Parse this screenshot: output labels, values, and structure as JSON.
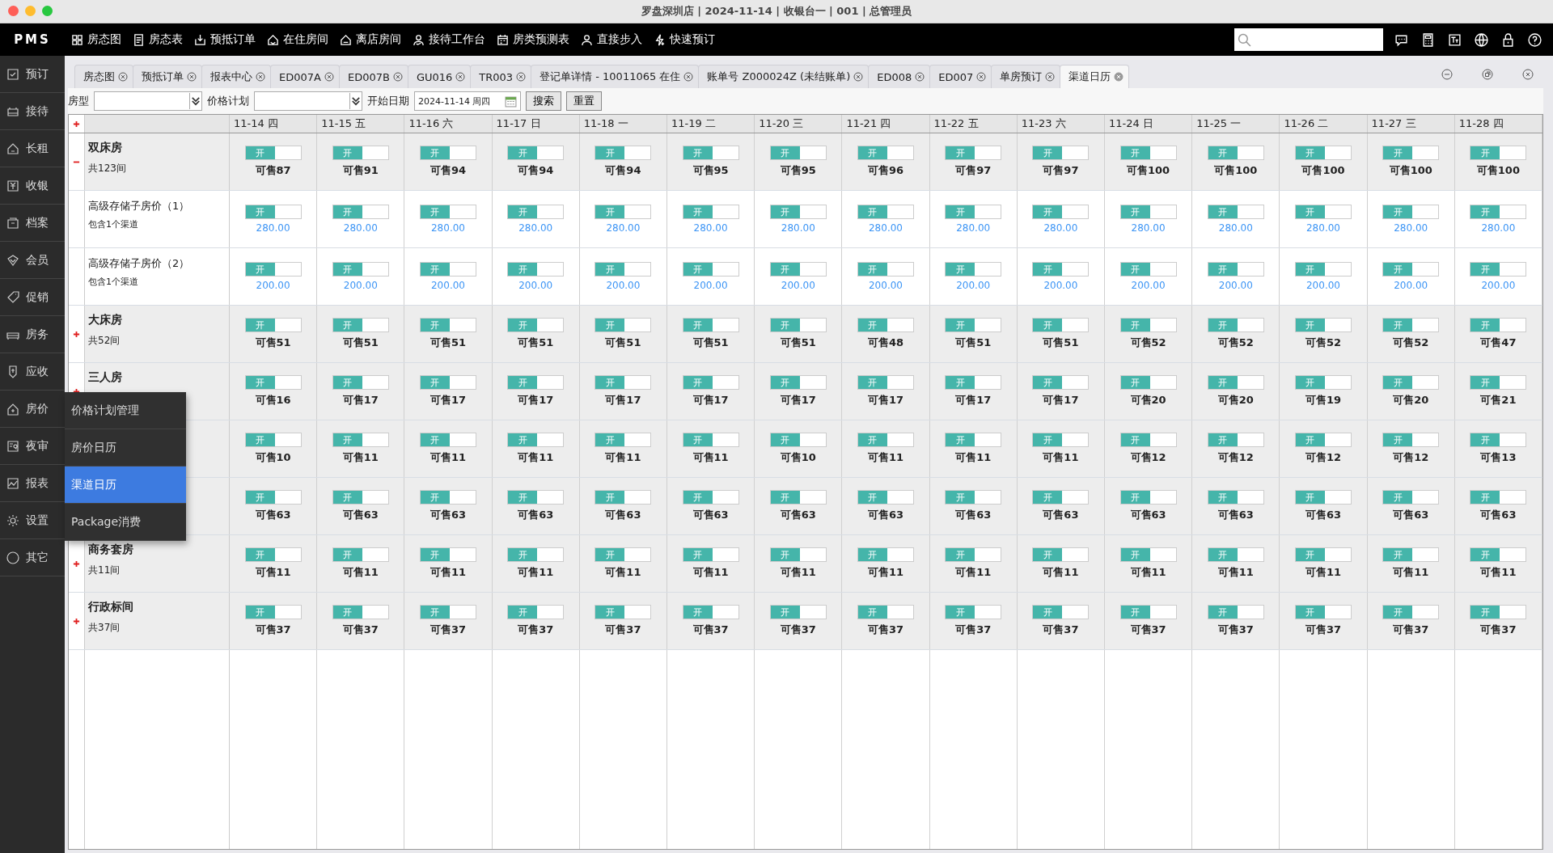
{
  "window": {
    "title": "罗盘深圳店 | 2024-11-14 | 收银台一 | 001 | 总管理员"
  },
  "logo": "PMS",
  "nav": [
    "房态图",
    "房态表",
    "预抵订单",
    "在住房间",
    "离店房间",
    "接待工作台",
    "房类预测表",
    "直接步入",
    "快速预订"
  ],
  "sidebar": {
    "items": [
      "预订",
      "接待",
      "长租",
      "收银",
      "档案",
      "会员",
      "促销",
      "房务",
      "应收",
      "房价",
      "夜审",
      "报表",
      "设置",
      "其它"
    ]
  },
  "popup_menu": {
    "items": [
      {
        "label": "价格计划管理",
        "selected": false
      },
      {
        "label": "房价日历",
        "selected": false
      },
      {
        "label": "渠道日历",
        "selected": true
      },
      {
        "label": "Package消费",
        "selected": false
      }
    ]
  },
  "tabs": [
    {
      "label": "房态图",
      "selected": false
    },
    {
      "label": "预抵订单",
      "selected": false
    },
    {
      "label": "报表中心",
      "selected": false
    },
    {
      "label": "ED007A",
      "selected": false
    },
    {
      "label": "ED007B",
      "selected": false
    },
    {
      "label": "GU016",
      "selected": false
    },
    {
      "label": "TR003",
      "selected": false
    },
    {
      "label": "登记单详情 - 10011065  在住",
      "selected": false
    },
    {
      "label": "账单号 Z000024Z (未结账单)",
      "selected": false
    },
    {
      "label": "ED008",
      "selected": false
    },
    {
      "label": "ED007",
      "selected": false
    },
    {
      "label": "单房预订",
      "selected": false
    },
    {
      "label": "渠道日历",
      "selected": true
    }
  ],
  "filters": {
    "room_type_label": "房型",
    "rate_plan_label": "价格计划",
    "start_date_label": "开始日期",
    "start_date": "2024-11-14 周四",
    "search_button": "搜索",
    "reset_button": "重置"
  },
  "table": {
    "columns": [
      "11-14 四",
      "11-15 五",
      "11-16 六",
      "11-17 日",
      "11-18 一",
      "11-19 二",
      "11-20 三",
      "11-21 四",
      "11-22 五",
      "11-23 六",
      "11-24 日",
      "11-25 一",
      "11-26 二",
      "11-27 三",
      "11-28 四"
    ],
    "rows": [
      {
        "kind": "group",
        "name": "双床房",
        "sub": "共123间",
        "expanded": true,
        "cells": [
          {
            "toggle": "开",
            "on": true,
            "value": "可售87"
          },
          {
            "toggle": "开",
            "on": true,
            "value": "可售91"
          },
          {
            "toggle": "开",
            "on": true,
            "value": "可售94"
          },
          {
            "toggle": "开",
            "on": true,
            "value": "可售94"
          },
          {
            "toggle": "开",
            "on": true,
            "value": "可售94"
          },
          {
            "toggle": "开",
            "on": true,
            "value": "可售95"
          },
          {
            "toggle": "开",
            "on": true,
            "value": "可售95"
          },
          {
            "toggle": "开",
            "on": true,
            "value": "可售96"
          },
          {
            "toggle": "开",
            "on": true,
            "value": "可售97"
          },
          {
            "toggle": "开",
            "on": true,
            "value": "可售97"
          },
          {
            "toggle": "开",
            "on": true,
            "value": "可售100"
          },
          {
            "toggle": "开",
            "on": true,
            "value": "可售100"
          },
          {
            "toggle": "开",
            "on": true,
            "value": "可售100"
          },
          {
            "toggle": "开",
            "on": true,
            "value": "可售100"
          },
          {
            "toggle": "开",
            "on": true,
            "value": "可售100"
          }
        ]
      },
      {
        "kind": "plan",
        "name": "高级存储子房价（1）",
        "sub": "包含1个渠道",
        "cells": [
          {
            "toggle": "开",
            "on": true,
            "value": "280.00"
          },
          {
            "toggle": "开",
            "on": true,
            "value": "280.00"
          },
          {
            "toggle": "开",
            "on": true,
            "value": "280.00"
          },
          {
            "toggle": "开",
            "on": true,
            "value": "280.00"
          },
          {
            "toggle": "开",
            "on": true,
            "value": "280.00"
          },
          {
            "toggle": "开",
            "on": true,
            "value": "280.00"
          },
          {
            "toggle": "开",
            "on": true,
            "value": "280.00"
          },
          {
            "toggle": "开",
            "on": true,
            "value": "280.00"
          },
          {
            "toggle": "开",
            "on": true,
            "value": "280.00"
          },
          {
            "toggle": "开",
            "on": true,
            "value": "280.00"
          },
          {
            "toggle": "开",
            "on": true,
            "value": "280.00"
          },
          {
            "toggle": "开",
            "on": true,
            "value": "280.00"
          },
          {
            "toggle": "开",
            "on": true,
            "value": "280.00"
          },
          {
            "toggle": "开",
            "on": true,
            "value": "280.00"
          },
          {
            "toggle": "开",
            "on": true,
            "value": "280.00"
          }
        ]
      },
      {
        "kind": "plan",
        "name": "高级存储子房价（2）",
        "sub": "包含1个渠道",
        "cells": [
          {
            "toggle": "开",
            "on": true,
            "value": "200.00"
          },
          {
            "toggle": "开",
            "on": true,
            "value": "200.00"
          },
          {
            "toggle": "开",
            "on": true,
            "value": "200.00"
          },
          {
            "toggle": "开",
            "on": true,
            "value": "200.00"
          },
          {
            "toggle": "开",
            "on": true,
            "value": "200.00"
          },
          {
            "toggle": "开",
            "on": true,
            "value": "200.00"
          },
          {
            "toggle": "开",
            "on": true,
            "value": "200.00"
          },
          {
            "toggle": "开",
            "on": true,
            "value": "200.00"
          },
          {
            "toggle": "开",
            "on": true,
            "value": "200.00"
          },
          {
            "toggle": "开",
            "on": true,
            "value": "200.00"
          },
          {
            "toggle": "开",
            "on": true,
            "value": "200.00"
          },
          {
            "toggle": "开",
            "on": true,
            "value": "200.00"
          },
          {
            "toggle": "开",
            "on": true,
            "value": "200.00"
          },
          {
            "toggle": "开",
            "on": true,
            "value": "200.00"
          },
          {
            "toggle": "开",
            "on": true,
            "value": "200.00"
          }
        ]
      },
      {
        "kind": "group",
        "name": "大床房",
        "sub": "共52间",
        "expanded": false,
        "cells": [
          {
            "toggle": "开",
            "on": true,
            "value": "可售51"
          },
          {
            "toggle": "开",
            "on": true,
            "value": "可售51"
          },
          {
            "toggle": "开",
            "on": true,
            "value": "可售51"
          },
          {
            "toggle": "开",
            "on": true,
            "value": "可售51"
          },
          {
            "toggle": "开",
            "on": true,
            "value": "可售51"
          },
          {
            "toggle": "开",
            "on": true,
            "value": "可售51"
          },
          {
            "toggle": "开",
            "on": true,
            "value": "可售51"
          },
          {
            "toggle": "开",
            "on": true,
            "value": "可售48"
          },
          {
            "toggle": "开",
            "on": true,
            "value": "可售51"
          },
          {
            "toggle": "开",
            "on": true,
            "value": "可售51"
          },
          {
            "toggle": "开",
            "on": true,
            "value": "可售52"
          },
          {
            "toggle": "开",
            "on": true,
            "value": "可售52"
          },
          {
            "toggle": "开",
            "on": true,
            "value": "可售52"
          },
          {
            "toggle": "开",
            "on": true,
            "value": "可售52"
          },
          {
            "toggle": "开",
            "on": true,
            "value": "可售47"
          }
        ]
      },
      {
        "kind": "group",
        "name": "三人房",
        "expanded": false,
        "cells": [
          {
            "toggle": "开",
            "on": true,
            "value": "可售16"
          },
          {
            "toggle": "开",
            "on": true,
            "value": "可售17"
          },
          {
            "toggle": "开",
            "on": true,
            "value": "可售17"
          },
          {
            "toggle": "开",
            "on": true,
            "value": "可售17"
          },
          {
            "toggle": "开",
            "on": true,
            "value": "可售17"
          },
          {
            "toggle": "开",
            "on": true,
            "value": "可售17"
          },
          {
            "toggle": "开",
            "on": true,
            "value": "可售17"
          },
          {
            "toggle": "开",
            "on": true,
            "value": "可售17"
          },
          {
            "toggle": "开",
            "on": true,
            "value": "可售17"
          },
          {
            "toggle": "开",
            "on": true,
            "value": "可售17"
          },
          {
            "toggle": "开",
            "on": true,
            "value": "可售20"
          },
          {
            "toggle": "开",
            "on": true,
            "value": "可售20"
          },
          {
            "toggle": "开",
            "on": true,
            "value": "可售19"
          },
          {
            "toggle": "开",
            "on": true,
            "value": "可售20"
          },
          {
            "toggle": "开",
            "on": true,
            "value": "可售21"
          }
        ]
      },
      {
        "kind": "group",
        "cells": [
          {
            "toggle": "开",
            "on": true,
            "value": "可售10"
          },
          {
            "toggle": "开",
            "on": true,
            "value": "可售11"
          },
          {
            "toggle": "开",
            "on": true,
            "value": "可售11"
          },
          {
            "toggle": "开",
            "on": true,
            "value": "可售11"
          },
          {
            "toggle": "开",
            "on": true,
            "value": "可售11"
          },
          {
            "toggle": "开",
            "on": true,
            "value": "可售11"
          },
          {
            "toggle": "开",
            "on": true,
            "value": "可售10"
          },
          {
            "toggle": "开",
            "on": true,
            "value": "可售11"
          },
          {
            "toggle": "开",
            "on": true,
            "value": "可售11"
          },
          {
            "toggle": "开",
            "on": true,
            "value": "可售11"
          },
          {
            "toggle": "开",
            "on": true,
            "value": "可售12"
          },
          {
            "toggle": "开",
            "on": true,
            "value": "可售12"
          },
          {
            "toggle": "开",
            "on": true,
            "value": "可售12"
          },
          {
            "toggle": "开",
            "on": true,
            "value": "可售12"
          },
          {
            "toggle": "开",
            "on": true,
            "value": "可售13"
          }
        ]
      },
      {
        "kind": "group",
        "cells": [
          {
            "toggle": "开",
            "on": true,
            "value": "可售63"
          },
          {
            "toggle": "开",
            "on": true,
            "value": "可售63"
          },
          {
            "toggle": "开",
            "on": true,
            "value": "可售63"
          },
          {
            "toggle": "开",
            "on": true,
            "value": "可售63"
          },
          {
            "toggle": "开",
            "on": true,
            "value": "可售63"
          },
          {
            "toggle": "开",
            "on": true,
            "value": "可售63"
          },
          {
            "toggle": "开",
            "on": true,
            "value": "可售63"
          },
          {
            "toggle": "开",
            "on": true,
            "value": "可售63"
          },
          {
            "toggle": "开",
            "on": true,
            "value": "可售63"
          },
          {
            "toggle": "开",
            "on": true,
            "value": "可售63"
          },
          {
            "toggle": "开",
            "on": true,
            "value": "可售63"
          },
          {
            "toggle": "开",
            "on": true,
            "value": "可售63"
          },
          {
            "toggle": "开",
            "on": true,
            "value": "可售63"
          },
          {
            "toggle": "开",
            "on": true,
            "value": "可售63"
          },
          {
            "toggle": "开",
            "on": true,
            "value": "可售63"
          }
        ]
      },
      {
        "kind": "group",
        "name": "商务套房",
        "sub": "共11间",
        "expanded": false,
        "cells": [
          {
            "toggle": "开",
            "on": true,
            "value": "可售11"
          },
          {
            "toggle": "开",
            "on": true,
            "value": "可售11"
          },
          {
            "toggle": "开",
            "on": true,
            "value": "可售11"
          },
          {
            "toggle": "开",
            "on": true,
            "value": "可售11"
          },
          {
            "toggle": "开",
            "on": true,
            "value": "可售11"
          },
          {
            "toggle": "开",
            "on": true,
            "value": "可售11"
          },
          {
            "toggle": "开",
            "on": true,
            "value": "可售11"
          },
          {
            "toggle": "开",
            "on": true,
            "value": "可售11"
          },
          {
            "toggle": "开",
            "on": true,
            "value": "可售11"
          },
          {
            "toggle": "开",
            "on": true,
            "value": "可售11"
          },
          {
            "toggle": "开",
            "on": true,
            "value": "可售11"
          },
          {
            "toggle": "开",
            "on": true,
            "value": "可售11"
          },
          {
            "toggle": "开",
            "on": true,
            "value": "可售11"
          },
          {
            "toggle": "开",
            "on": true,
            "value": "可售11"
          },
          {
            "toggle": "开",
            "on": true,
            "value": "可售11"
          }
        ]
      },
      {
        "kind": "group",
        "name": "行政标间",
        "sub": "共37间",
        "expanded": false,
        "cells": [
          {
            "toggle": "开",
            "on": true,
            "value": "可售37"
          },
          {
            "toggle": "开",
            "on": true,
            "value": "可售37"
          },
          {
            "toggle": "开",
            "on": true,
            "value": "可售37"
          },
          {
            "toggle": "开",
            "on": true,
            "value": "可售37"
          },
          {
            "toggle": "开",
            "on": true,
            "value": "可售37"
          },
          {
            "toggle": "开",
            "on": true,
            "value": "可售37"
          },
          {
            "toggle": "开",
            "on": true,
            "value": "可售37"
          },
          {
            "toggle": "开",
            "on": true,
            "value": "可售37"
          },
          {
            "toggle": "开",
            "on": true,
            "value": "可售37"
          },
          {
            "toggle": "开",
            "on": true,
            "value": "可售37"
          },
          {
            "toggle": "开",
            "on": true,
            "value": "可售37"
          },
          {
            "toggle": "开",
            "on": true,
            "value": "可售37"
          },
          {
            "toggle": "开",
            "on": true,
            "value": "可售37"
          },
          {
            "toggle": "开",
            "on": true,
            "value": "可售37"
          },
          {
            "toggle": "开",
            "on": true,
            "value": "可售37"
          }
        ]
      }
    ]
  }
}
